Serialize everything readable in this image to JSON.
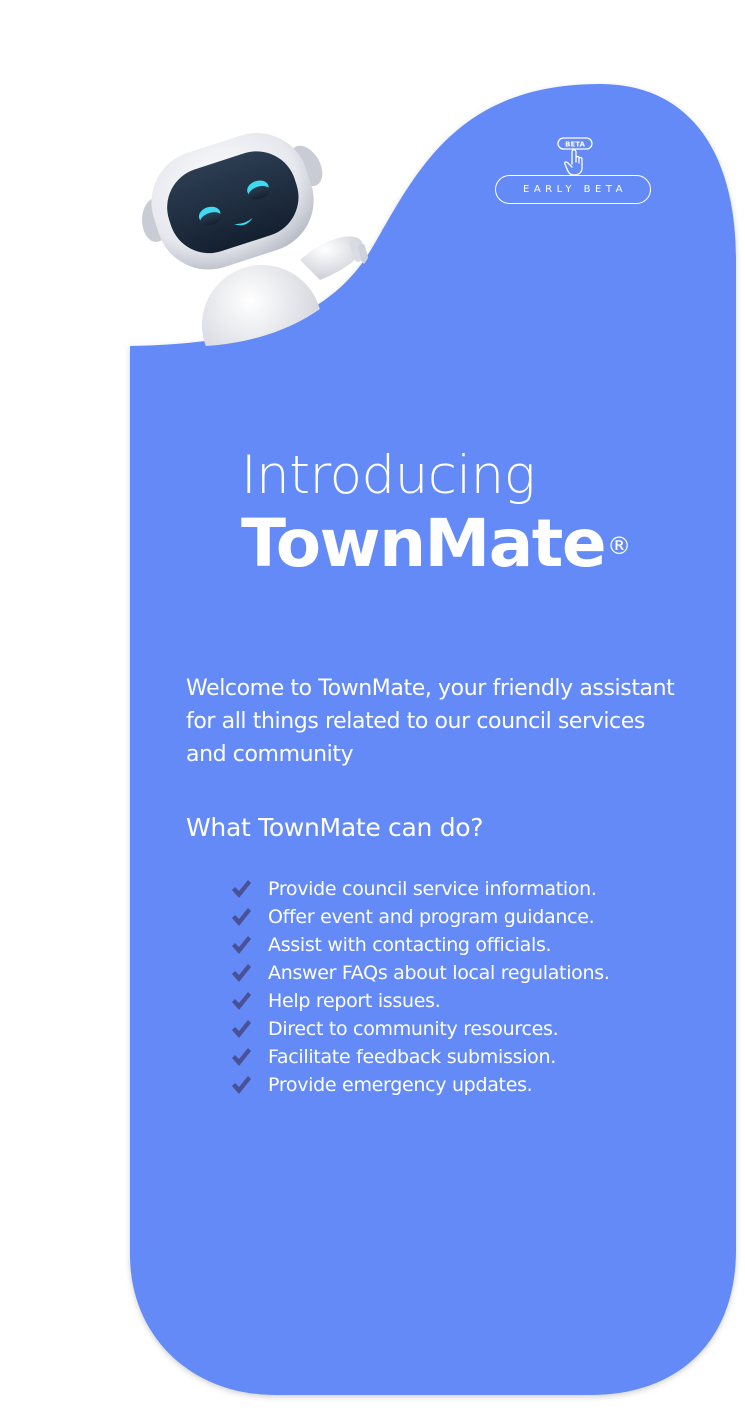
{
  "beta": {
    "hand_badge_text": "BETA",
    "pill_label": "EARLY BETA"
  },
  "headline": {
    "intro": "Introducing",
    "brand": "TownMate",
    "trademark": "®"
  },
  "welcome_text": "Welcome to TownMate, your friendly assistant for all things related to our council services and community",
  "capabilities": {
    "title": "What TownMate can do?",
    "items": [
      "Provide council service information.",
      "Offer event and program guidance.",
      "Assist with contacting officials.",
      "Answer FAQs about local regulations.",
      "Help report issues.",
      "Direct to community resources.",
      "Facilitate feedback submission.",
      "Provide emergency updates."
    ]
  },
  "colors": {
    "card": "#648af7",
    "text": "#ffffff",
    "check": "#4a5199",
    "robot_face": "#1c2b3c",
    "robot_eyes": "#3fd9f0"
  },
  "icons": {
    "mascot": "robot-mascot",
    "hand": "pointing-hand-icon",
    "check": "checkmark-icon"
  }
}
